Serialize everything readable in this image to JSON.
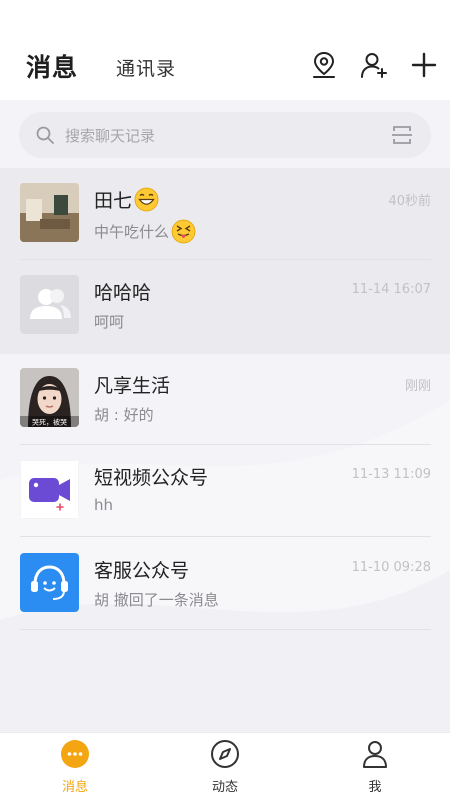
{
  "header": {
    "tab_messages": "消息",
    "tab_contacts": "通讯录",
    "icons": [
      "location-pin-icon",
      "add-friend-icon",
      "plus-icon"
    ]
  },
  "search": {
    "placeholder": "搜索聊天记录"
  },
  "chats": [
    {
      "name": "田七",
      "name_emoji": "grinning-face-emoji",
      "preview": "中午吃什么",
      "preview_emoji": "tongue-out-squint-emoji",
      "time": "40秒前",
      "pinned": true
    },
    {
      "name": "哈哈哈",
      "preview": "呵呵",
      "time": "11-14 16:07",
      "pinned": true
    },
    {
      "name": "凡享生活",
      "preview": "胡 : 好的",
      "time": "刚刚",
      "pinned": false
    },
    {
      "name": "短视频公众号",
      "preview": "hh",
      "time": "11-13 11:09",
      "pinned": false
    },
    {
      "name": "客服公众号",
      "preview": "胡 撤回了一条消息",
      "time": "11-10 09:28",
      "pinned": false
    }
  ],
  "avatar_caption": "哭死，被哭",
  "nav": [
    {
      "label": "消息",
      "icon": "chat-bubble-icon",
      "active": true
    },
    {
      "label": "动态",
      "icon": "compass-icon",
      "active": false
    },
    {
      "label": "我",
      "icon": "person-icon",
      "active": false
    }
  ],
  "colors": {
    "accent": "#f3a512",
    "video_purple": "#6b4bd3",
    "service_blue": "#2b8cf2"
  }
}
